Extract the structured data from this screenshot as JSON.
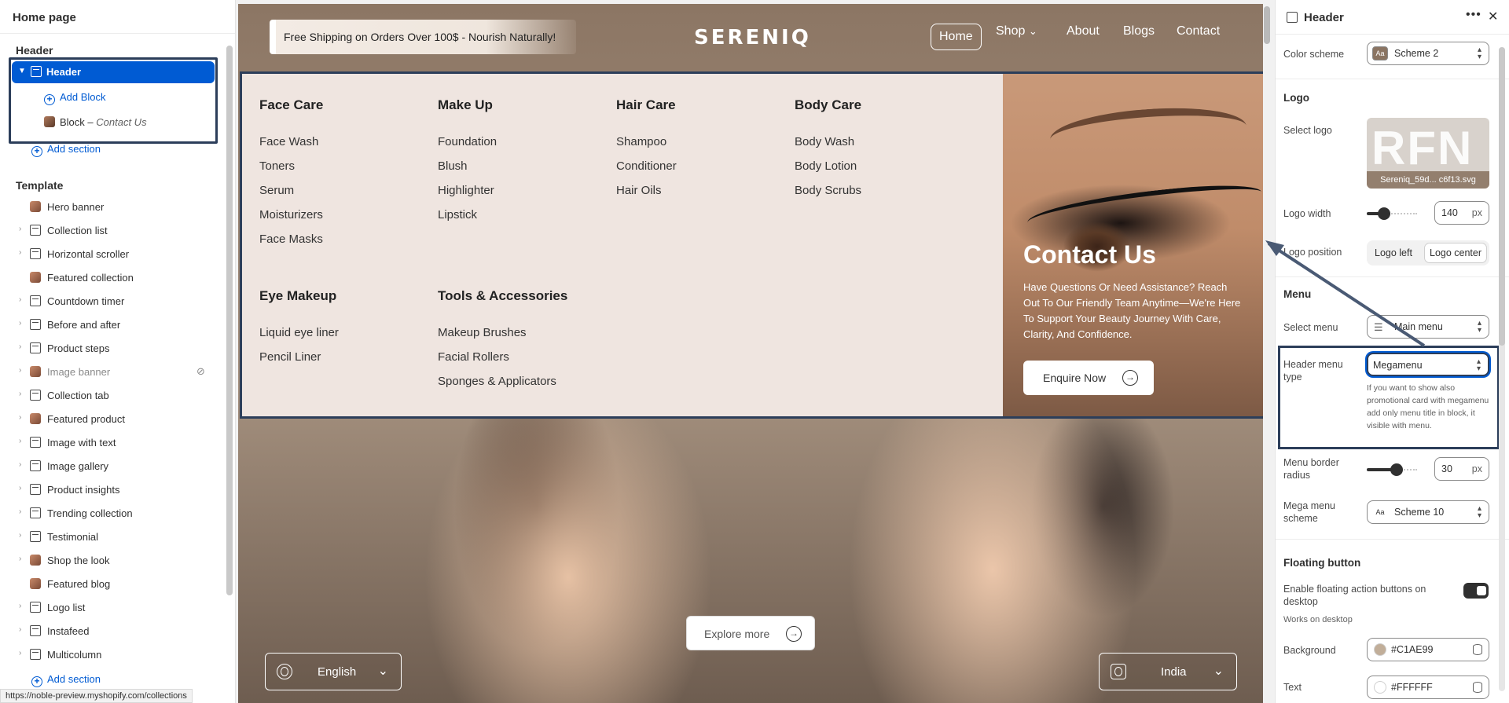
{
  "left": {
    "title": "Home page",
    "header_section_label": "Header",
    "header_item": "Header",
    "add_block": "Add Block",
    "block_prefix": "Block",
    "block_name": "Contact Us",
    "add_section_top": "Add section",
    "template_label": "Template",
    "template_items": [
      {
        "label": "Hero banner",
        "expandable": false,
        "icon": "image-thumb"
      },
      {
        "label": "Collection list",
        "expandable": true,
        "icon": "section-icon"
      },
      {
        "label": "Horizontal scroller",
        "expandable": true,
        "icon": "section-icon"
      },
      {
        "label": "Featured collection",
        "expandable": false,
        "icon": "image-thumb"
      },
      {
        "label": "Countdown timer",
        "expandable": true,
        "icon": "section-icon"
      },
      {
        "label": "Before and after",
        "expandable": true,
        "icon": "section-icon"
      },
      {
        "label": "Product steps",
        "expandable": true,
        "icon": "section-icon"
      },
      {
        "label": "Image banner",
        "expandable": true,
        "icon": "image-thumb",
        "hidden": true
      },
      {
        "label": "Collection tab",
        "expandable": true,
        "icon": "section-icon"
      },
      {
        "label": "Featured product",
        "expandable": true,
        "icon": "image-thumb"
      },
      {
        "label": "Image with text",
        "expandable": true,
        "icon": "section-icon"
      },
      {
        "label": "Image gallery",
        "expandable": true,
        "icon": "section-icon"
      },
      {
        "label": "Product insights",
        "expandable": true,
        "icon": "section-icon"
      },
      {
        "label": "Trending collection",
        "expandable": true,
        "icon": "section-icon"
      },
      {
        "label": "Testimonial",
        "expandable": true,
        "icon": "section-icon"
      },
      {
        "label": "Shop the look",
        "expandable": true,
        "icon": "image-thumb"
      },
      {
        "label": "Featured blog",
        "expandable": false,
        "icon": "image-thumb"
      },
      {
        "label": "Logo list",
        "expandable": true,
        "icon": "section-icon"
      },
      {
        "label": "Instafeed",
        "expandable": true,
        "icon": "section-icon"
      },
      {
        "label": "Multicolumn",
        "expandable": true,
        "icon": "section-icon"
      }
    ],
    "add_section_bottom": "Add section",
    "status_url": "https://noble-preview.myshopify.com/collections"
  },
  "preview": {
    "promo_text": "Free Shipping on Orders Over 100$ - Nourish Naturally!",
    "logo": "SERENIQ",
    "nav": [
      {
        "label": "Home",
        "active": true
      },
      {
        "label": "Shop",
        "dropdown": true
      },
      {
        "label": "About"
      },
      {
        "label": "Blogs"
      },
      {
        "label": "Contact"
      }
    ],
    "mega_columns": [
      {
        "title": "Face Care",
        "items": [
          "Face Wash",
          "Toners",
          "Serum",
          "Moisturizers",
          "Face Masks"
        ]
      },
      {
        "title": "Make Up",
        "items": [
          "Foundation",
          "Blush",
          "Highlighter",
          "Lipstick"
        ]
      },
      {
        "title": "Hair Care",
        "items": [
          "Shampoo",
          "Conditioner",
          "Hair Oils"
        ]
      },
      {
        "title": "Body Care",
        "items": [
          "Body Wash",
          "Body Lotion",
          "Body Scrubs"
        ]
      },
      {
        "title": "Eye Makeup",
        "items": [
          "Liquid eye liner",
          "Pencil Liner"
        ]
      },
      {
        "title": "Tools & Accessories",
        "items": [
          "Makeup Brushes",
          "Facial Rollers",
          "Sponges & Applicators"
        ]
      }
    ],
    "promo_card": {
      "title": "Contact Us",
      "text": "Have Questions Or Need Assistance? Reach Out To Our Friendly Team Anytime—We're Here To Support Your Beauty Journey With Care, Clarity, And Confidence.",
      "button": "Enquire Now"
    },
    "explore_button": "Explore more",
    "language": "English",
    "country": "India"
  },
  "right": {
    "title": "Header",
    "color_scheme_label": "Color scheme",
    "color_scheme_value": "Scheme 2",
    "logo_heading": "Logo",
    "select_logo_label": "Select logo",
    "logo_file": "Sereniq_59d... c6f13.svg",
    "logo_width_label": "Logo width",
    "logo_width_value": "140",
    "logo_width_unit": "px",
    "logo_width_fraction": 0.35,
    "logo_position_label": "Logo position",
    "logo_left": "Logo left",
    "logo_center": "Logo center",
    "menu_heading": "Menu",
    "select_menu_label": "Select menu",
    "select_menu_value": "Main menu",
    "header_menu_type_label": "Header menu type",
    "header_menu_type_value": "Megamenu",
    "header_menu_help": "If you want to show also promotional card with megamenu add only menu title in block, it visible with menu.",
    "menu_border_radius_label": "Menu border radius",
    "menu_border_radius_value": "30",
    "menu_border_radius_unit": "px",
    "menu_border_radius_fraction": 0.6,
    "mega_menu_scheme_label": "Mega menu scheme",
    "mega_menu_scheme_value": "Scheme 10",
    "floating_heading": "Floating button",
    "floating_enable_label": "Enable floating action buttons on desktop",
    "floating_note": "Works on desktop",
    "background_label": "Background",
    "background_value": "#C1AE99",
    "text_label": "Text",
    "text_value": "#FFFFFF"
  },
  "colors": {
    "accent": "#005bd3",
    "highlight_border": "#2c3e5a",
    "mega_bg": "#efe5e0"
  }
}
